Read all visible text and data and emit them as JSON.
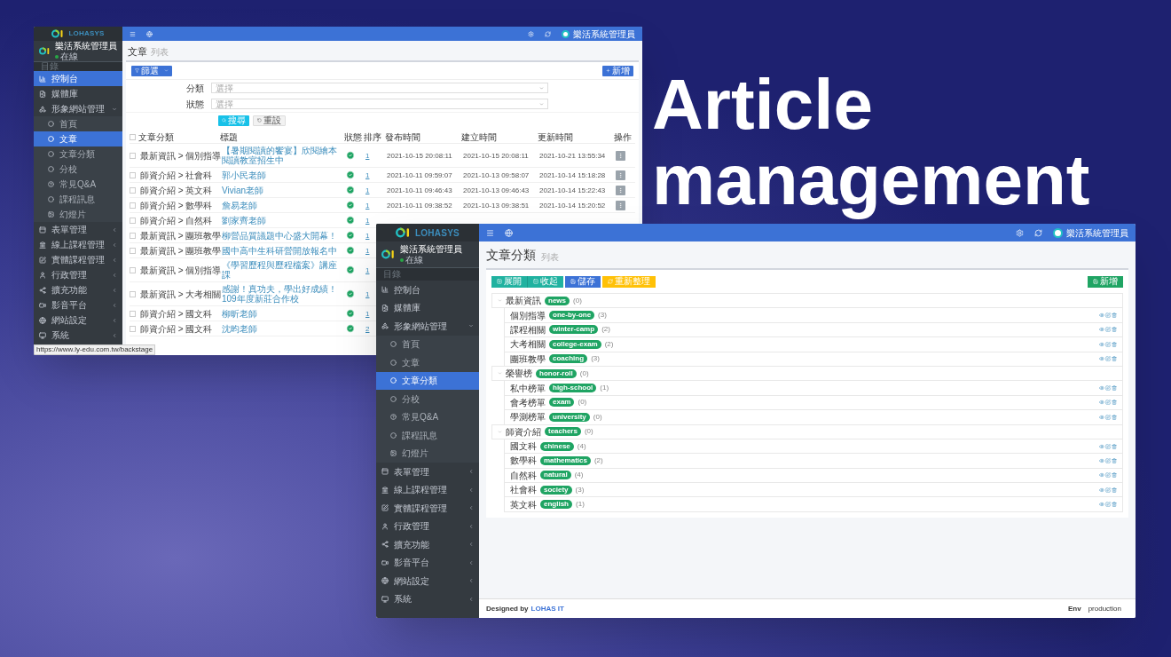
{
  "headline": "Article management",
  "back_window": {
    "brand": "LOHASYS",
    "user": {
      "name": "樂活系統管理員",
      "status": "在線",
      "online": true
    },
    "nav_label": "目錄",
    "header_user": "樂活系統管理員",
    "sidebar": [
      {
        "label": "控制台",
        "selected": true
      },
      {
        "label": "媒體庫",
        "selected": false
      },
      {
        "label": "形象網站管理",
        "selected": false,
        "expanded": true,
        "children": [
          {
            "label": "首頁",
            "selected": false
          },
          {
            "label": "文章",
            "selected": true
          },
          {
            "label": "文章分類",
            "selected": false
          },
          {
            "label": "分校",
            "selected": false
          },
          {
            "label": "常見Q&A",
            "selected": false
          },
          {
            "label": "課程訊息",
            "selected": false
          },
          {
            "label": "幻燈片",
            "selected": false
          }
        ]
      },
      {
        "label": "表單管理",
        "selected": false,
        "expanded": false
      },
      {
        "label": "線上課程管理",
        "selected": false,
        "expanded": false
      },
      {
        "label": "實體課程管理",
        "selected": false,
        "expanded": false
      },
      {
        "label": "行政管理",
        "selected": false,
        "expanded": false
      },
      {
        "label": "擴充功能",
        "selected": false,
        "expanded": false
      },
      {
        "label": "影音平台",
        "selected": false,
        "expanded": false
      },
      {
        "label": "網站設定",
        "selected": false,
        "expanded": false
      },
      {
        "label": "系統",
        "selected": false,
        "expanded": false
      }
    ],
    "page_title": "文章",
    "page_subtitle": "列表",
    "filter_button": "篩選",
    "add_button": "新增",
    "filters": [
      {
        "label": "分類",
        "placeholder": "選擇"
      },
      {
        "label": "狀態",
        "placeholder": "選擇"
      }
    ],
    "search_button": "搜尋",
    "reset_button": "重設",
    "table": {
      "select_all": false,
      "columns": [
        "文章分類",
        "標題",
        "狀態",
        "排序",
        "發布時間",
        "建立時間",
        "更新時間",
        "操作"
      ],
      "rows": [
        {
          "checked": false,
          "category": "最新資訊 > 個別指導",
          "title": "【暑期閱讀的饗宴】欣閱繪本閱讀教室招生中",
          "published": true,
          "order": "1",
          "published_at": "2021-10-15 20:08:11",
          "created_at": "2021-10-15 20:08:11",
          "updated_at": "2021-10-21 13:55:34"
        },
        {
          "checked": false,
          "category": "師資介紹 > 社會科",
          "title": "郭小民老師",
          "published": true,
          "order": "1",
          "published_at": "2021-10-11 09:59:07",
          "created_at": "2021-10-13 09:58:07",
          "updated_at": "2021-10-14 15:18:28"
        },
        {
          "checked": false,
          "category": "師資介紹 > 英文科",
          "title": "Vivian老師",
          "published": true,
          "order": "1",
          "published_at": "2021-10-11 09:46:43",
          "created_at": "2021-10-13 09:46:43",
          "updated_at": "2021-10-14 15:22:43"
        },
        {
          "checked": false,
          "category": "師資介紹 > 數學科",
          "title": "詹易老師",
          "published": true,
          "order": "1",
          "published_at": "2021-10-11 09:38:52",
          "created_at": "2021-10-13 09:38:51",
          "updated_at": "2021-10-14 15:20:52"
        },
        {
          "checked": false,
          "category": "師資介紹 > 自然科",
          "title": "劉家齊老師",
          "published": true,
          "order": "1"
        },
        {
          "checked": false,
          "category": "最新資訊 > 團班教學",
          "title": "柳營品質議題中心盛大開幕！",
          "published": true,
          "order": "1"
        },
        {
          "checked": false,
          "category": "最新資訊 > 團班教學",
          "title": "國中高中生科研營開放報名中",
          "published": true,
          "order": "1"
        },
        {
          "checked": false,
          "category": "最新資訊 > 個別指導",
          "title": "《學習歷程與歷程檔案》講座課",
          "published": true,
          "order": "1"
        },
        {
          "checked": false,
          "category": "最新資訊 > 大考相關",
          "title": "感謝！真功夫，學出好成績！109年度新莊合作校",
          "published": true,
          "order": "1"
        },
        {
          "checked": false,
          "category": "師資介紹 > 國文科",
          "title": "柳昕老師",
          "published": true,
          "order": "1"
        },
        {
          "checked": false,
          "category": "師資介紹 > 國文科",
          "title": "沈昀老師",
          "published": true,
          "order": "2"
        }
      ]
    },
    "status_url": "https://www.ly-edu.com.tw/backstage"
  },
  "front_window": {
    "brand": "LOHASYS",
    "user": {
      "name": "樂活系統管理員",
      "status": "在線",
      "online": true
    },
    "nav_label": "目錄",
    "header_user": "樂活系統管理員",
    "sidebar": [
      {
        "label": "控制台",
        "selected": false
      },
      {
        "label": "媒體庫",
        "selected": false
      },
      {
        "label": "形象網站管理",
        "selected": false,
        "expanded": true,
        "children": [
          {
            "label": "首頁",
            "selected": false
          },
          {
            "label": "文章",
            "selected": false
          },
          {
            "label": "文章分類",
            "selected": true
          },
          {
            "label": "分校",
            "selected": false
          },
          {
            "label": "常見Q&A",
            "selected": false
          },
          {
            "label": "課程訊息",
            "selected": false
          },
          {
            "label": "幻燈片",
            "selected": false
          }
        ]
      },
      {
        "label": "表單管理",
        "selected": false,
        "expanded": false
      },
      {
        "label": "線上課程管理",
        "selected": false,
        "expanded": false
      },
      {
        "label": "實體課程管理",
        "selected": false,
        "expanded": false
      },
      {
        "label": "行政管理",
        "selected": false,
        "expanded": false
      },
      {
        "label": "擴充功能",
        "selected": false,
        "expanded": false
      },
      {
        "label": "影音平台",
        "selected": false,
        "expanded": false
      },
      {
        "label": "網站設定",
        "selected": false,
        "expanded": false
      },
      {
        "label": "系統",
        "selected": false,
        "expanded": false
      }
    ],
    "page_title": "文章分類",
    "page_subtitle": "列表",
    "toolbar": [
      {
        "label": "展開",
        "kind": "expand"
      },
      {
        "label": "收起",
        "kind": "collapse"
      },
      {
        "label": "儲存",
        "kind": "save"
      },
      {
        "label": "重新整理",
        "kind": "refresh"
      }
    ],
    "add_button": "新增",
    "tree": [
      {
        "name": "最新資訊",
        "slug": "news",
        "count": "(0)",
        "expanded": true,
        "children": [
          {
            "name": "個別指導",
            "slug": "one-by-one",
            "count": "(3)"
          },
          {
            "name": "課程相關",
            "slug": "winter-camp",
            "count": "(2)"
          },
          {
            "name": "大考相關",
            "slug": "college-exam",
            "count": "(2)"
          },
          {
            "name": "團班教學",
            "slug": "coaching",
            "count": "(3)"
          }
        ]
      },
      {
        "name": "榮譽榜",
        "slug": "honor-roll",
        "count": "(0)",
        "expanded": true,
        "children": [
          {
            "name": "私中榜單",
            "slug": "high-school",
            "count": "(1)"
          },
          {
            "name": "會考榜單",
            "slug": "exam",
            "count": "(0)"
          },
          {
            "name": "學測榜單",
            "slug": "university",
            "count": "(0)"
          }
        ]
      },
      {
        "name": "師資介紹",
        "slug": "teachers",
        "count": "(0)",
        "expanded": true,
        "children": [
          {
            "name": "國文科",
            "slug": "chinese",
            "count": "(4)"
          },
          {
            "name": "數學科",
            "slug": "mathematics",
            "count": "(2)"
          },
          {
            "name": "自然科",
            "slug": "natural",
            "count": "(4)"
          },
          {
            "name": "社會科",
            "slug": "society",
            "count": "(3)"
          },
          {
            "name": "英文科",
            "slug": "english",
            "count": "(1)"
          }
        ]
      }
    ],
    "footer": {
      "designed_by": "Designed by",
      "company": "LOHAS IT",
      "env_label": "Env",
      "env_value": "production"
    }
  }
}
